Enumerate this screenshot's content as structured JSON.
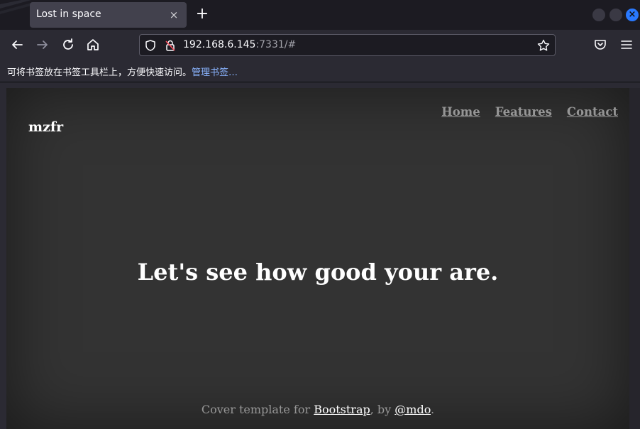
{
  "browser": {
    "tab_title": "Lost in space",
    "tab_close": "×",
    "new_tab": "+",
    "url_host": "192.168.6.145",
    "url_rest": ":7331/#",
    "bookmarks_hint": "可将书签放在书签工具栏上，方便快速访问。",
    "bookmarks_link": "管理书签…",
    "window_close": "×"
  },
  "site": {
    "brand": "mzfr",
    "nav": [
      "Home",
      "Features",
      "Contact"
    ],
    "headline": "Let's see how good your are.",
    "footer": {
      "prefix": "Cover template for ",
      "link1": "Bootstrap",
      "middle": ", by ",
      "link2": "@mdo",
      "suffix": "."
    }
  },
  "icons": {
    "back": "arrow-left-icon",
    "forward": "arrow-right-icon",
    "reload": "reload-icon",
    "home": "home-icon",
    "shield": "shield-icon",
    "lock": "lock-insecure-icon",
    "star": "star-icon",
    "pocket": "pocket-icon",
    "menu": "hamburger-menu-icon"
  },
  "colors": {
    "chrome_dark": "#1c1b22",
    "chrome": "#2b2a33",
    "tab_active": "#42414d",
    "page_bg": "#333333",
    "link_blue": "#8ab4ff",
    "close_blue": "#2979ff"
  }
}
